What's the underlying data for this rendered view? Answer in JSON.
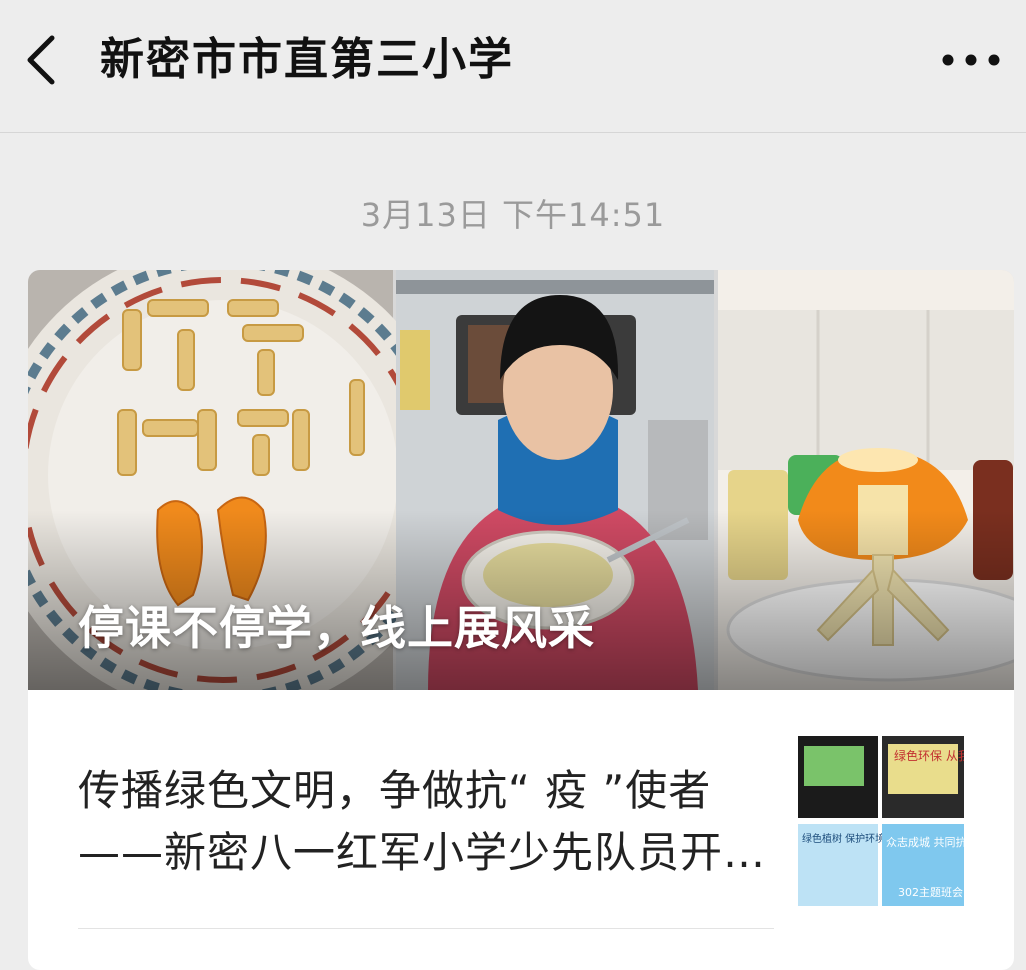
{
  "header": {
    "back_icon": "chevron-left-icon",
    "title": "新密市市直第三小学",
    "more_icon": "more-dots-icon"
  },
  "timestamp": "3月13日 下午14:51",
  "card": {
    "cover_title": "停课不停学，线上展风采",
    "articles": [
      {
        "title": "传播绿色文明，争做抗“ 疫 ”使者——新密八一红军小学少先队员开展主题活动",
        "thumbnail_texts": [
          "绿色环保 从我做起",
          "绿色植树 保护环境",
          "众志成城 共同抗疫",
          "302主题班会"
        ]
      }
    ]
  },
  "colors": {
    "background": "#ededed",
    "card": "#ffffff",
    "title_text": "#111111",
    "timestamp_text": "#9a9a9a"
  }
}
